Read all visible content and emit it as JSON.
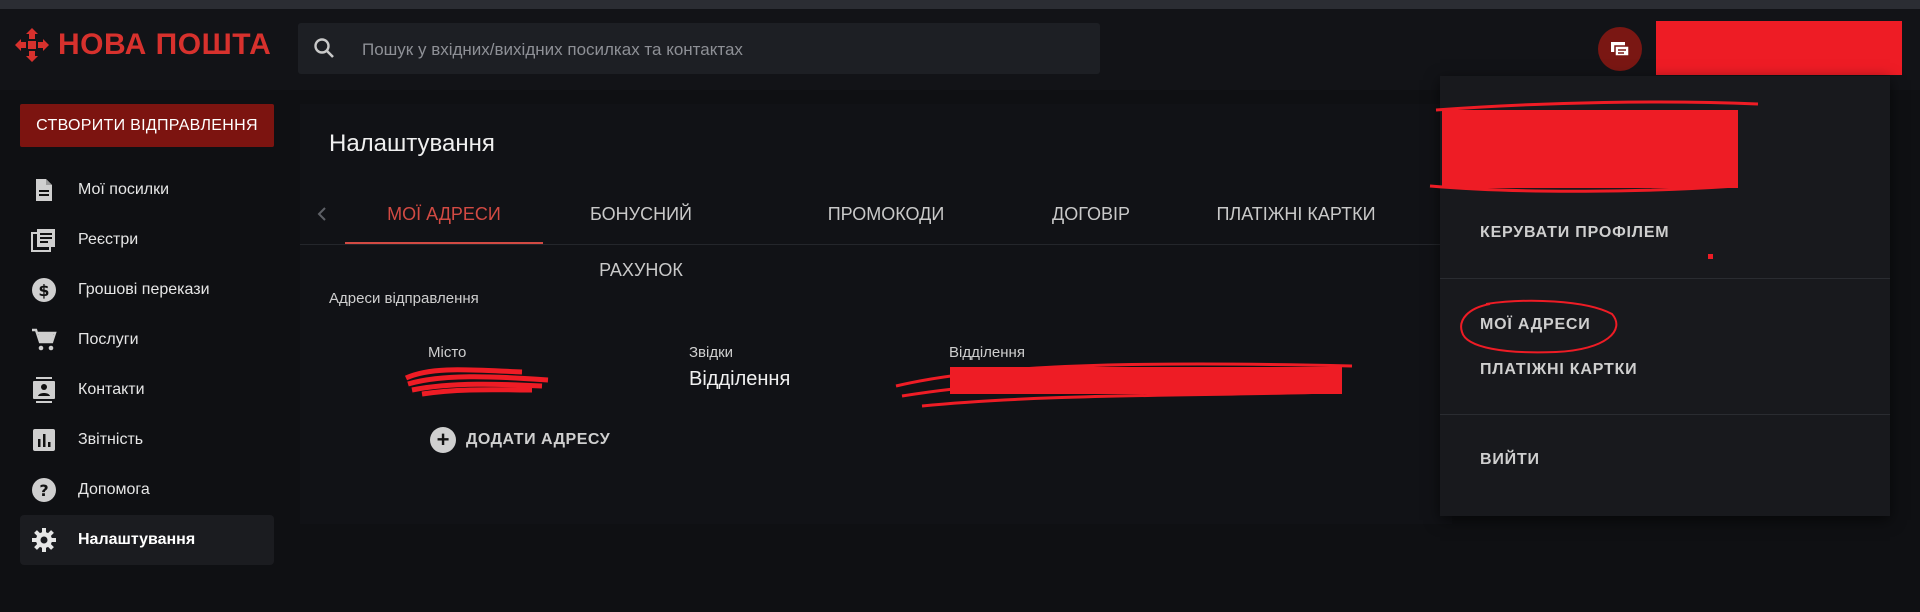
{
  "header": {
    "logo_text": "НОВА ПОШТА",
    "search_placeholder": "Пошук у вхідних/вихідних посилках та контактах"
  },
  "sidebar": {
    "create_button": "СТВОРИТИ ВІДПРАВЛЕННЯ",
    "items": [
      {
        "label": "Мої посилки",
        "icon": "document-icon"
      },
      {
        "label": "Реєстри",
        "icon": "registry-icon"
      },
      {
        "label": "Грошові перекази",
        "icon": "dollar-icon"
      },
      {
        "label": "Послуги",
        "icon": "cart-icon"
      },
      {
        "label": "Контакти",
        "icon": "contacts-icon"
      },
      {
        "label": "Звітність",
        "icon": "chart-icon"
      },
      {
        "label": "Допомога",
        "icon": "help-icon"
      },
      {
        "label": "Налаштування",
        "icon": "gear-icon",
        "active": true
      }
    ]
  },
  "main": {
    "title": "Налаштування",
    "tabs": [
      {
        "label": "МОЇ АДРЕСИ",
        "active": true
      },
      {
        "label": "БОНУСНИЙ РАХУНОК"
      },
      {
        "label": "ПРОМОКОДИ"
      },
      {
        "label": "ДОГОВІР"
      },
      {
        "label": "ПЛАТІЖНІ КАРТКИ"
      }
    ],
    "section_label": "Адреси відправлення",
    "columns": {
      "city": "Місто",
      "from": "Звідки",
      "branch": "Відділення"
    },
    "row": {
      "from_value": "Відділення"
    },
    "add_address": "ДОДАТИ АДРЕСУ"
  },
  "dropdown": {
    "manage_profile": "КЕРУВАТИ ПРОФІЛЕМ",
    "my_addresses": "МОЇ АДРЕСИ",
    "payment_cards": "ПЛАТІЖНІ КАРТКИ",
    "logout": "ВИЙТИ"
  },
  "colors": {
    "brand_red": "#d7312d",
    "active_tab": "#d24a43",
    "redaction": "#ee1c25",
    "create_button_bg": "#7c1410"
  }
}
